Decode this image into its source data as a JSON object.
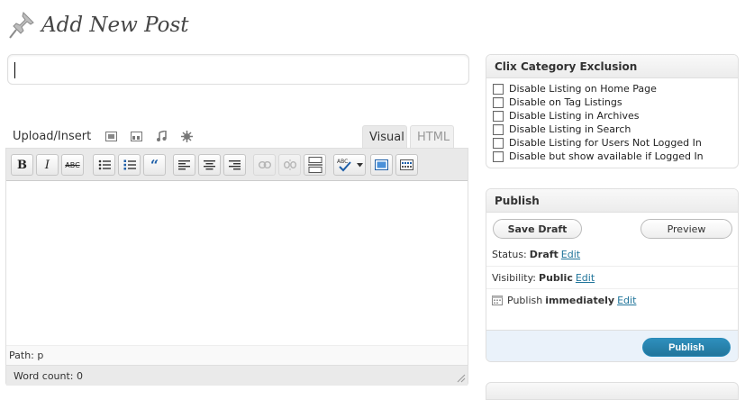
{
  "header": {
    "title": "Add New Post",
    "icon": "pushpin-icon"
  },
  "title_input": {
    "value": "",
    "placeholder": ""
  },
  "upload": {
    "label": "Upload/Insert",
    "icons": [
      "add-image-icon",
      "add-video-icon",
      "add-audio-icon",
      "add-media-icon"
    ]
  },
  "editor_tabs": {
    "visual": "Visual",
    "html": "HTML",
    "active": "Visual"
  },
  "toolbar": {
    "bold": "B",
    "italic": "I",
    "strike": "ABC",
    "buttons": [
      "bold",
      "italic",
      "strikethrough",
      "unordered-list",
      "ordered-list",
      "blockquote",
      "align-left",
      "align-center",
      "align-right",
      "insert-link",
      "unlink",
      "insert-more",
      "spellcheck",
      "fullscreen",
      "kitchen-sink"
    ]
  },
  "editor": {
    "path_label": "Path: p",
    "word_count": "Word count: 0"
  },
  "clix": {
    "title": "Clix Category Exclusion",
    "options": [
      "Disable Listing on Home Page",
      "Disable on Tag Listings",
      "Disable Listing in Archives",
      "Disable Listing in Search",
      "Disable Listing for Users Not Logged In",
      "Disable but show available if Logged In"
    ]
  },
  "publish": {
    "title": "Publish",
    "save_draft": "Save Draft",
    "preview": "Preview",
    "status_label": "Status:",
    "status_value": "Draft",
    "visibility_label": "Visibility:",
    "visibility_value": "Public",
    "publish_label": "Publish",
    "publish_value": "immediately",
    "edit": "Edit",
    "publish_button": "Publish"
  },
  "colors": {
    "primary": "#21759b",
    "link": "#21759b",
    "panel_bg": "#eaf2fa"
  }
}
